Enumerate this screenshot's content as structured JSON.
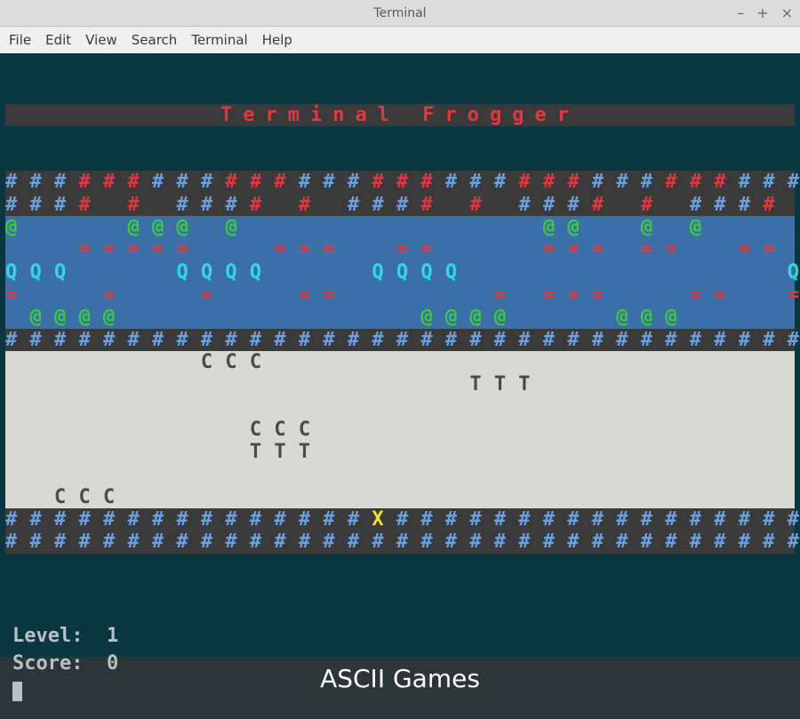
{
  "window": {
    "title": "Terminal",
    "controls": {
      "minimize": "–",
      "maximize": "+",
      "close": "×"
    }
  },
  "menu": {
    "items": [
      "File",
      "Edit",
      "View",
      "Search",
      "Terminal",
      "Help"
    ]
  },
  "game": {
    "title": "Terminal Frogger",
    "cols": 33,
    "rows": [
      {
        "bg": "bg-dark",
        "cells": "BBBRRRBBBRRRBBBRRRBBBRRRBBBRRRBBB",
        "charmap": {
          "B": {
            "ch": "#",
            "cls": "c-blue"
          },
          "R": {
            "ch": "#",
            "cls": "c-red"
          }
        }
      },
      {
        "bg": "bg-dark",
        "cells": "BBBR R BBBR R BBBR R BBBR R BBBR ",
        "charmap": {
          "B": {
            "ch": "#",
            "cls": "c-blue"
          },
          "R": {
            "ch": "#",
            "cls": "c-red"
          },
          " ": {
            "ch": " ",
            "cls": ""
          }
        }
      },
      {
        "bg": "bg-river",
        "cells": "G    GGG G            GG  G G    ",
        "charmap": {
          "G": {
            "ch": "@",
            "cls": "c-green"
          },
          " ": {
            "ch": " ",
            "cls": ""
          }
        }
      },
      {
        "bg": "bg-river",
        "cells": "   =====   ===  ==    === ==  == ",
        "charmap": {
          "=": {
            "ch": "=",
            "cls": "c-red"
          },
          " ": {
            "ch": " ",
            "cls": ""
          }
        }
      },
      {
        "bg": "bg-river",
        "cells": "QQQ    QQQQ    QQQQ             Q",
        "charmap": {
          "Q": {
            "ch": "Q",
            "cls": "c-cyan"
          },
          " ": {
            "ch": " ",
            "cls": ""
          }
        }
      },
      {
        "bg": "bg-river",
        "cells": "=   =   =   ==      = ===   ==  =",
        "charmap": {
          "=": {
            "ch": "=",
            "cls": "c-red"
          },
          " ": {
            "ch": " ",
            "cls": ""
          }
        }
      },
      {
        "bg": "bg-river",
        "cells": " GGGG            GGGG    GGG     ",
        "charmap": {
          "G": {
            "ch": "@",
            "cls": "c-green"
          },
          " ": {
            "ch": " ",
            "cls": ""
          }
        }
      },
      {
        "bg": "bg-dark",
        "cells": "BBBBBBBBBBBBBBBBBBBBBBBBBBBBBBBBB",
        "charmap": {
          "B": {
            "ch": "#",
            "cls": "c-blue"
          }
        }
      },
      {
        "bg": "bg-road",
        "cells": "        CCC                      ",
        "charmap": {
          "C": {
            "ch": "C",
            "cls": "c-grey"
          },
          " ": {
            "ch": " ",
            "cls": ""
          }
        }
      },
      {
        "bg": "bg-road",
        "cells": "                   TTT           ",
        "charmap": {
          "T": {
            "ch": "T",
            "cls": "c-grey"
          },
          " ": {
            "ch": " ",
            "cls": ""
          }
        }
      },
      {
        "bg": "bg-road",
        "cells": "                                 ",
        "charmap": {
          " ": {
            "ch": " ",
            "cls": ""
          }
        }
      },
      {
        "bg": "bg-road",
        "cells": "          CCC                    ",
        "charmap": {
          "C": {
            "ch": "C",
            "cls": "c-grey"
          },
          " ": {
            "ch": " ",
            "cls": ""
          }
        }
      },
      {
        "bg": "bg-road",
        "cells": "          TTT                    ",
        "charmap": {
          "T": {
            "ch": "T",
            "cls": "c-grey"
          },
          " ": {
            "ch": " ",
            "cls": ""
          }
        }
      },
      {
        "bg": "bg-road",
        "cells": "                                 ",
        "charmap": {
          " ": {
            "ch": " ",
            "cls": ""
          }
        }
      },
      {
        "bg": "bg-road",
        "cells": "  CCC                            ",
        "charmap": {
          "C": {
            "ch": "C",
            "cls": "c-grey"
          },
          " ": {
            "ch": " ",
            "cls": ""
          }
        }
      },
      {
        "bg": "bg-dark",
        "cells": "BBBBBBBBBBBBBBBXBBBBBBBBBBBBBBBBB",
        "charmap": {
          "B": {
            "ch": "#",
            "cls": "c-blue"
          },
          "X": {
            "ch": "X",
            "cls": "c-yellow"
          }
        }
      },
      {
        "bg": "bg-dark",
        "cells": "BBBBBBBBBBBBBBBBBBBBBBBBBBBBBBBBB",
        "charmap": {
          "B": {
            "ch": "#",
            "cls": "c-blue"
          }
        }
      }
    ]
  },
  "status": {
    "level_label": "Level:",
    "level_value": "1",
    "score_label": "Score:",
    "score_value": "0"
  },
  "caption": "ASCII Games"
}
